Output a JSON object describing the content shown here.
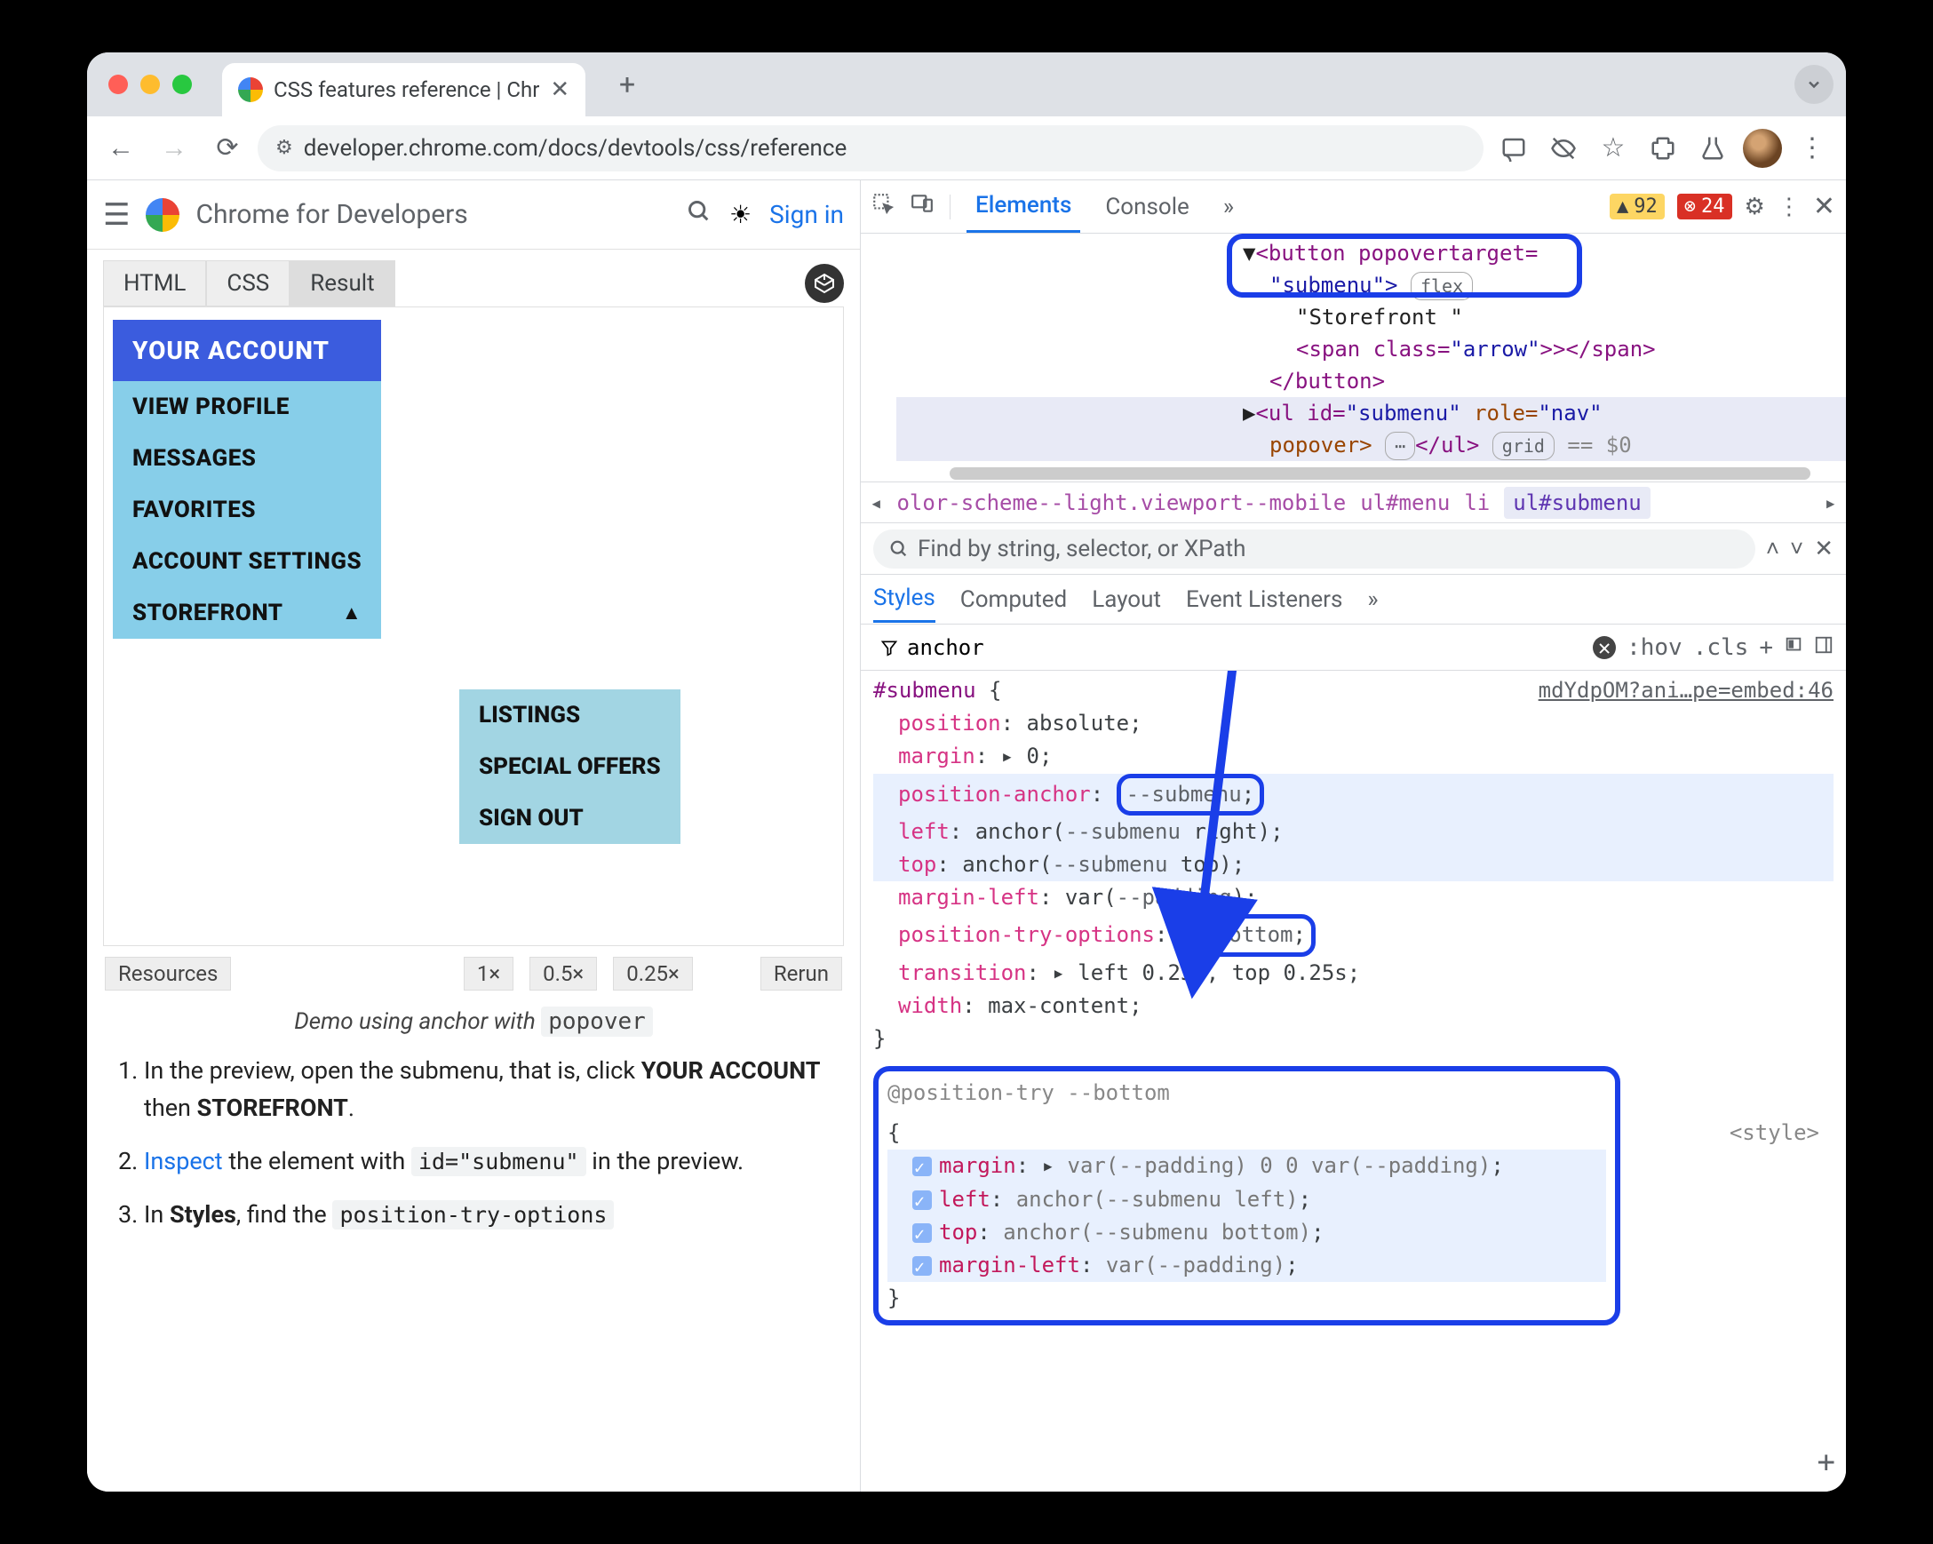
{
  "browser": {
    "tab_title": "CSS features reference | Chr",
    "url": "developer.chrome.com/docs/devtools/css/reference"
  },
  "page": {
    "site_title": "Chrome for Developers",
    "signin": "Sign in",
    "demo_tabs": {
      "html": "HTML",
      "css": "CSS",
      "result": "Result"
    },
    "menu_header": "YOUR ACCOUNT",
    "menu_items": [
      "VIEW PROFILE",
      "MESSAGES",
      "FAVORITES",
      "ACCOUNT SETTINGS",
      "STOREFRONT"
    ],
    "submenu_items": [
      "LISTINGS",
      "SPECIAL OFFERS",
      "SIGN OUT"
    ],
    "footer": {
      "resources": "Resources",
      "x1": "1×",
      "x05": "0.5×",
      "x025": "0.25×",
      "rerun": "Rerun"
    },
    "caption_prefix": "Demo using anchor with ",
    "caption_code": "popover",
    "steps": {
      "s1a": "In the preview, open the submenu, that is, click ",
      "s1b": "YOUR ACCOUNT",
      "s1c": " then ",
      "s1d": "STOREFRONT",
      "s1e": ".",
      "s2a": "Inspect",
      "s2b": " the element with ",
      "s2code": "id=\"submenu\"",
      "s2c": " in the preview.",
      "s3a": "In ",
      "s3b": "Styles",
      "s3c": ", find the ",
      "s3code": "position-try-options"
    }
  },
  "devtools": {
    "tabs": {
      "elements": "Elements",
      "console": "Console"
    },
    "warn_count": "92",
    "err_count": "24",
    "dom": {
      "l1": "<button popovertarget=",
      "l1b": "\"submenu\">",
      "badge_flex": "flex",
      "l2": "\"Storefront \"",
      "l3a": "<span class=",
      "l3b": "\"arrow\"",
      "l3c": ">></span>",
      "l4": "</button>",
      "l5a": "<ul id=",
      "l5b": "\"submenu\"",
      "l5c": " role=",
      "l5d": "\"nav\"",
      "l6a": "popover>",
      "l6b": "</ul>",
      "badge_grid": "grid",
      "eqsize": "== $0"
    },
    "breadcrumb": {
      "long": "olor-scheme--light.viewport--mobile",
      "b2": "ul#menu",
      "b3": "li",
      "b4": "ul#submenu"
    },
    "search_placeholder": "Find by string, selector, or XPath",
    "styles_tabs": {
      "styles": "Styles",
      "computed": "Computed",
      "layout": "Layout",
      "events": "Event Listeners"
    },
    "filter_text": "anchor",
    "hov": ":hov",
    "cls": ".cls",
    "source": "mdYdpOM?ani…pe=embed:46",
    "rule": {
      "selector": "#submenu",
      "p_position": "position",
      "v_position": "absolute",
      "p_margin": "margin",
      "v_margin": "0",
      "p_anchor": "position-anchor",
      "v_anchor": "--submenu",
      "p_left": "left",
      "v_left_a": "anchor(",
      "v_left_var": "--submenu",
      "v_left_b": " right)",
      "p_top": "top",
      "v_top_a": "anchor(",
      "v_top_var": "--submenu",
      "v_top_b": " top)",
      "p_ml": "margin-left",
      "v_ml_a": "var(",
      "v_ml_var": "--padding",
      "v_ml_b": ")",
      "p_pto": "position-try-options",
      "v_pto": "--bottom",
      "p_trans": "transition",
      "v_trans": "left 0.25s, top 0.25s",
      "p_width": "width",
      "v_width": "max-content"
    },
    "rule2": {
      "header": "@position-try --bottom",
      "style_link": "<style>",
      "r1": {
        "p": "margin",
        "v": "var(--padding) 0 0 var(--padding)"
      },
      "r2": {
        "p": "left",
        "a": "anchor(",
        "var": "--submenu",
        "b": " left)"
      },
      "r3": {
        "p": "top",
        "a": "anchor(",
        "var": "--submenu",
        "b": " bottom)"
      },
      "r4": {
        "p": "margin-left",
        "a": "var(",
        "var": "--padding",
        "b": ")"
      }
    }
  }
}
